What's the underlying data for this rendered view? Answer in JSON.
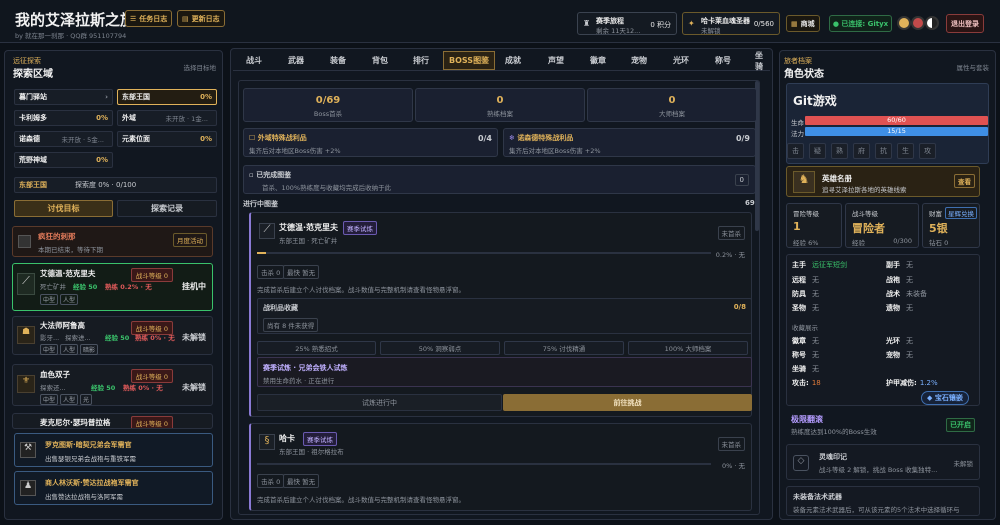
{
  "header": {
    "title": "我的艾泽拉斯之旅",
    "subtitle": "by 就在那一刹那 · QQ群 951107794",
    "btn_tasks": "任务日志",
    "btn_update": "更新日志",
    "season": {
      "title": "赛季旅程",
      "sub": "剩余 11天12...",
      "points": "0 积分"
    },
    "hunter": {
      "title": "哈卡莱血魂圣器",
      "sub": "未解锁",
      "count": "0/560"
    },
    "shop": "商城",
    "connected": "● 已连接: Gityx",
    "logout": "退出登录"
  },
  "left": {
    "cap": "远征探索",
    "title": "探索区域",
    "right": "选择目标地",
    "zones": [
      {
        "name": "暮门驿站",
        "mid": "",
        "val": "›"
      },
      {
        "name": "东部王国",
        "mid": "",
        "val": "0%"
      },
      {
        "name": "卡利姆多",
        "mid": "",
        "val": "0%"
      },
      {
        "name": "外域",
        "mid": "未开放 · 1金...",
        "val": ""
      },
      {
        "name": "诺森德",
        "mid": "未开放 · 5金...",
        "val": ""
      },
      {
        "name": "元素位面",
        "mid": "",
        "val": "0%"
      },
      {
        "name": "荒野神域",
        "mid": "",
        "val": "0%"
      }
    ],
    "region": "东部王国",
    "explore": "探索度 0% · 0/100",
    "tab1": "讨伐目标",
    "tab2": "探索记录",
    "event": {
      "title": "疯狂的刺那",
      "sub": "本期已结束，等待下期",
      "tag": "月度活动"
    },
    "monsters": [
      {
        "name": "艾德温·范克里夫",
        "loc": "死亡矿井",
        "exp": "经验 50",
        "drop": "熟练 0.2% · 无",
        "level": "战斗等级 0",
        "tags": [
          "中型",
          "人型"
        ],
        "state": "挂机中"
      },
      {
        "name": "大法师阿鲁高",
        "loc": "影牙...",
        "sub2": "探索进...",
        "exp": "经验 50",
        "drop": "熟练 0% · 无",
        "level": "战斗等级 0",
        "tags": [
          "中型",
          "人型",
          "暗影"
        ],
        "state": "未解锁"
      },
      {
        "name": "血色双子",
        "loc": "探索还...",
        "exp": "经验 50",
        "drop": "熟练 0% · 无",
        "level": "战斗等级 0",
        "tags": [
          "中型",
          "人型",
          "光"
        ],
        "state": "未解锁"
      },
      {
        "name": "麦克尼尔·瑟玛普拉格",
        "level": "战斗等级 0"
      }
    ],
    "quests": [
      {
        "title": "罗克图斯·暗契兄弟会军需官",
        "sub": "出售瑟银兄弟会战袍与重铁军需"
      },
      {
        "title": "商人林沃斯·赞达拉战袍军需官",
        "sub": "出售赞达拉战袍与洛阿军需"
      }
    ]
  },
  "center": {
    "tabs": [
      "战斗",
      "武器",
      "装备",
      "背包",
      "排行",
      "BOSS图鉴",
      "成就",
      "声望",
      "徽章",
      "宠物",
      "光环",
      "称号",
      "坐骑"
    ],
    "stats": [
      {
        "value": "0/69",
        "label": "Boss首杀"
      },
      {
        "value": "0",
        "label": "熟练档案"
      },
      {
        "value": "0",
        "label": "大师档案"
      }
    ],
    "tracks": [
      {
        "title": "外域特殊战利品",
        "sub": "集齐后对本地区Boss伤害 +2%",
        "count": "0/4"
      },
      {
        "title": "诺森德特殊战利品",
        "sub": "集齐后对本地区Boss伤害 +2%",
        "count": "0/9"
      }
    ],
    "done": {
      "title": "已完成图鉴",
      "sub": "首杀、100%熟练度与收藏均完成后收纳于此",
      "count": "0"
    },
    "progress_label": "进行中图鉴",
    "progress_count": "69",
    "boss1": {
      "name": "艾德温·范克里夫",
      "badge": "赛季试炼",
      "loc": "东部王国 · 死亡矿井",
      "state": "未首杀",
      "pct": "0.2% · 无",
      "progress": 0.002,
      "kill": "击杀 0",
      "fast": "最快 暂无",
      "desc": "完成首杀后建立个人讨伐档案。战斗数值与完整机制请查看怪物悬浮窗。",
      "loot_title": "战利品收藏",
      "loot_count": "0/8",
      "loot_sub": "尚有 8 件未获得",
      "milestones": [
        "25% 熟悉招式",
        "50% 洞察弱点",
        "75% 讨伐精通",
        "100% 大师档案"
      ],
      "trial_title": "赛季试炼 · 兄弟会铁人试炼",
      "trial_sub": "禁用生命药水 · 正在进行",
      "btn_progress": "试炼进行中",
      "btn_go": "前往挑战"
    },
    "boss2": {
      "name": "哈卡",
      "badge": "赛季试炼",
      "loc": "东部王国 · 祖尔格拉布",
      "state": "未首杀",
      "pct": "0% · 无",
      "kill": "击杀 0",
      "fast": "最快 暂无",
      "desc": "完成首杀后建立个人讨伐档案。战斗数值与完整机制请查看怪物悬浮窗。"
    }
  },
  "right": {
    "cap": "旅者档案",
    "title": "角色状态",
    "right": "属性与套装",
    "name": "Git游戏",
    "hp_label": "生命",
    "hp": "60/60",
    "mp_label": "法力",
    "mp": "15/15",
    "skills": [
      "击",
      "疑",
      "熟",
      "府",
      "抗",
      "生",
      "攻"
    ],
    "title_card": {
      "name": "英雄名册",
      "sub": "追寻艾泽拉斯各地的英雄线索",
      "btn": "查看"
    },
    "adv": {
      "label": "冒险等级",
      "value": "1",
      "sub": "经验 6%"
    },
    "combat": {
      "label": "战斗等级",
      "value": "冒险者",
      "sub": "经验",
      "sub2": "0/300"
    },
    "wealth": {
      "label": "财富",
      "btn": "星辉兑换",
      "value": "5银",
      "sub": "钻石 0"
    },
    "equip": [
      {
        "k": "主手",
        "v": "远征军短剑",
        "hl": true
      },
      {
        "k": "副手",
        "v": "无"
      },
      {
        "k": "远程",
        "v": "无"
      },
      {
        "k": "战袍",
        "v": "无"
      },
      {
        "k": "防具",
        "v": "无"
      },
      {
        "k": "战术",
        "v": "未装备"
      },
      {
        "k": "圣物",
        "v": "无"
      },
      {
        "k": "遗物",
        "v": "无"
      }
    ],
    "coll_label": "收藏展示",
    "coll": [
      {
        "k": "徽章",
        "v": "无"
      },
      {
        "k": "光环",
        "v": "无"
      },
      {
        "k": "称号",
        "v": "无"
      },
      {
        "k": "宠物",
        "v": "无"
      },
      {
        "k": "坐骑",
        "v": "无"
      }
    ],
    "atk_label": "攻击:",
    "atk": "18",
    "armor_label": "护甲减伤:",
    "armor": "1.2%",
    "gem_btn": "◆ 宝石镶嵌",
    "ultimate": {
      "title": "极限翻滚",
      "sub": "熟练度达到100%的Boss生效",
      "state": "已开启"
    },
    "soul": {
      "title": "灵魂印记",
      "sub": "战斗等级 2 解锁，挑战 Boss 收集独特...",
      "state": "未解锁"
    },
    "legend": {
      "title": "未装备法术武器",
      "sub": "装备元素法术武器后，可从该元素的5个法术中选择循环与"
    }
  },
  "colors": {
    "accent": "#e0b25a",
    "hp": "#e05252",
    "mp": "#3f8fe6",
    "green": "#3ac26b",
    "purple": "#9b8ae6",
    "red": "#e05a5a"
  }
}
